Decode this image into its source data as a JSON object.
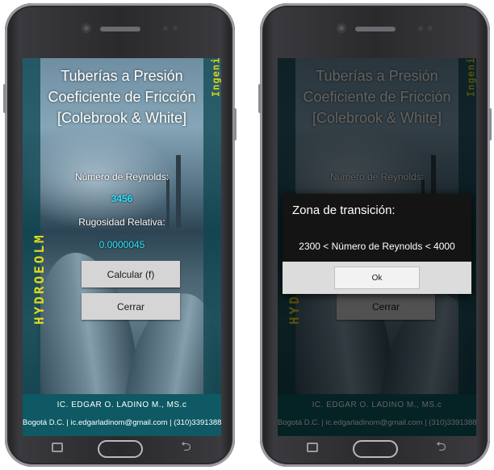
{
  "app": {
    "title_lines": [
      "Tuberías a Presión",
      "Coeficiente de Fricción",
      "[Colebrook & White]"
    ],
    "brand_vertical": "HYDROEOLM",
    "side_vertical": "Ingeniería Hidráulica",
    "reynolds_label": "Número de Reynolds:",
    "reynolds_value": "3456",
    "roughness_label": "Rugosidad Relativa:",
    "roughness_value": "0.0000045",
    "calc_button": "Calcular (f)",
    "close_button": "Cerrar",
    "author": "IC. EDGAR O. LADINO M., MS.c",
    "contact": "Bogotá D.C. | ic.edgarladinom@gmail.com | (310)3391388"
  },
  "dialog": {
    "title": "Zona de transición:",
    "message": "2300 < Número de Reynolds < 4000",
    "ok_button": "Ok"
  },
  "colors": {
    "accent_value": "#2ee6ff",
    "brand_yellow": "#e0d820",
    "footer_teal": "#0e5963"
  },
  "icons": {
    "nav_recent": "recent-apps-icon",
    "nav_home": "home-button",
    "nav_back": "back-icon"
  }
}
